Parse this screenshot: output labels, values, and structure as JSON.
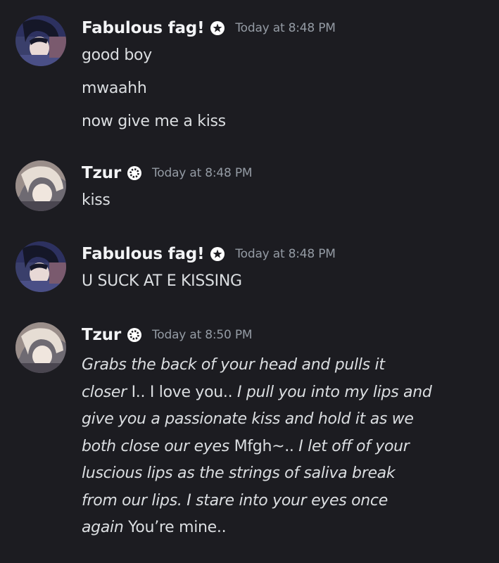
{
  "messages": [
    {
      "author": "Fabulous fag!",
      "timestamp": "Today at 8:48 PM",
      "lines": [
        "good boy",
        "mwaahh",
        "now give me a kiss"
      ]
    },
    {
      "author": "Tzur",
      "timestamp": "Today at 8:48 PM",
      "lines": [
        "kiss"
      ]
    },
    {
      "author": "Fabulous fag!",
      "timestamp": "Today at 8:48 PM",
      "lines": [
        "U SUCK AT E KISSING"
      ]
    },
    {
      "author": "Tzur",
      "timestamp": "Today at 8:50 PM",
      "rich_lines": [
        [
          {
            "text": "Grabs the back of your head and pulls it",
            "italic": true
          }
        ],
        [
          {
            "text": "closer",
            "italic": true
          },
          {
            "text": " I.. I love you.. ",
            "italic": false
          },
          {
            "text": "I pull you into my lips and",
            "italic": true
          }
        ],
        [
          {
            "text": "give you a passionate kiss and hold it as we",
            "italic": true
          }
        ],
        [
          {
            "text": "both close our eyes",
            "italic": true
          },
          {
            "text": " Mfgh~.. ",
            "italic": false
          },
          {
            "text": "I let off of your",
            "italic": true
          }
        ],
        [
          {
            "text": "luscious lips as the strings of saliva break",
            "italic": true
          }
        ],
        [
          {
            "text": "from our lips. I stare into your eyes once",
            "italic": true
          }
        ],
        [
          {
            "text": "again",
            "italic": true
          },
          {
            "text": " You’re mine..",
            "italic": false
          }
        ]
      ]
    }
  ]
}
